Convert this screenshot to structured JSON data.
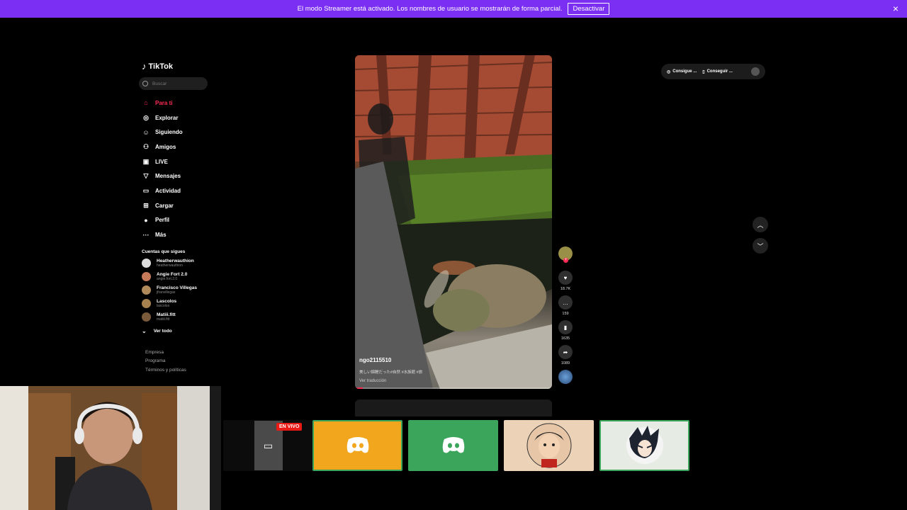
{
  "banner": {
    "text": "El modo Streamer está activado. Los nombres de usuario se mostrarán de forma parcial.",
    "button_label": "Desactivar",
    "close_icon": "×"
  },
  "sidebar": {
    "logo_text": "TikTok",
    "search_placeholder": "Buscar",
    "nav": [
      {
        "label": "Para ti",
        "icon": "home-icon",
        "active": true
      },
      {
        "label": "Explorar",
        "icon": "compass-icon"
      },
      {
        "label": "Siguiendo",
        "icon": "user-follow-icon"
      },
      {
        "label": "Amigos",
        "icon": "friends-icon"
      },
      {
        "label": "LIVE",
        "icon": "live-tv-icon"
      },
      {
        "label": "Mensajes",
        "icon": "send-icon"
      },
      {
        "label": "Actividad",
        "icon": "inbox-icon"
      },
      {
        "label": "Cargar",
        "icon": "plus-square-icon"
      },
      {
        "label": "Perfil",
        "icon": "profile-avatar-icon"
      },
      {
        "label": "Más",
        "icon": "more-icon"
      }
    ],
    "following_title": "Cuentas que sigues",
    "accounts": [
      {
        "name": "Heatherwauthion",
        "handle": "heatherwauthion"
      },
      {
        "name": "Angie Fort 2.0",
        "handle": "angie.fort.2.0"
      },
      {
        "name": "Francisco Villegas",
        "handle": "jfranvillegas"
      },
      {
        "name": "Lascolos",
        "handle": "lascolos"
      },
      {
        "name": "Matiii.fitt",
        "handle": "matiii.fitt"
      }
    ],
    "see_all": "Ver todo",
    "footer": [
      "Empresa",
      "Programa",
      "Términos y políticas"
    ]
  },
  "video": {
    "username": "ngo2115510",
    "caption": "美しい錦鯉だった#自然 #水族館 #旅",
    "translate": "Ver traducción",
    "progress": 0.04
  },
  "actions": {
    "like_count": "18.7K",
    "comment_count": "159",
    "save_count": "1635",
    "share_count": "1089"
  },
  "topright": {
    "item1": "Consigue ...",
    "item2": "Conseguir ..."
  },
  "stream": {
    "live_badge": "EN VIVO"
  },
  "colors": {
    "banner": "#7b2ff2",
    "accent": "#fe2c55",
    "tile_orange": "#f2a61d",
    "tile_green": "#3ba55c"
  }
}
